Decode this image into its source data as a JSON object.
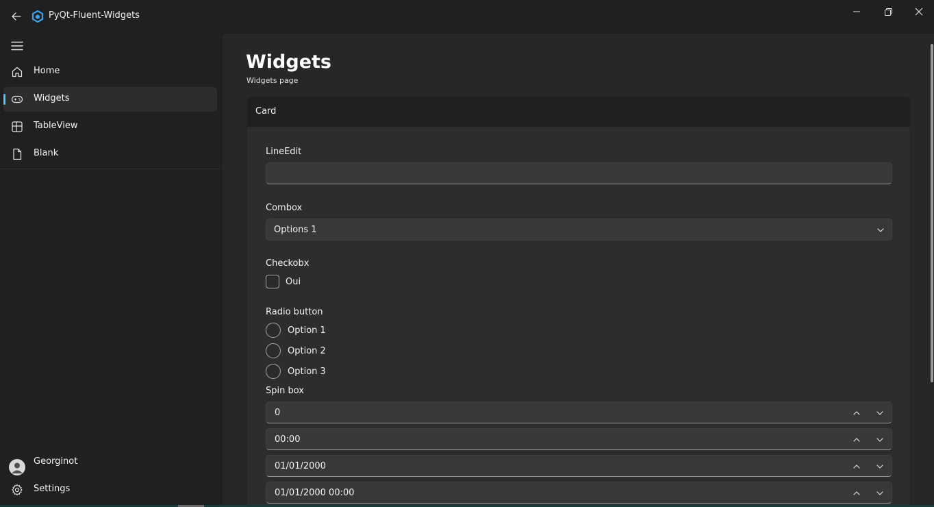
{
  "app": {
    "title": "PyQt-Fluent-Widgets"
  },
  "colors": {
    "accent": "#4cc2ff",
    "background": "#202020",
    "content": "#272727",
    "card": "#2d2d2d"
  },
  "sidebar": {
    "items": [
      {
        "label": "Home",
        "icon": "home-icon"
      },
      {
        "label": "Widgets",
        "icon": "gamepad-icon",
        "selected": true
      },
      {
        "label": "TableView",
        "icon": "table-icon"
      },
      {
        "label": "Blank",
        "icon": "document-icon"
      }
    ],
    "bottom": [
      {
        "label": "Georginot",
        "icon": "avatar"
      },
      {
        "label": "Settings",
        "icon": "gear-icon"
      }
    ]
  },
  "page": {
    "title": "Widgets",
    "subtitle": "Widgets page"
  },
  "card": {
    "header": "Card",
    "lineedit": {
      "label": "LineEdit",
      "value": ""
    },
    "combobox": {
      "label": "Combox",
      "value": "Options 1"
    },
    "checkbox": {
      "label": "Checkobx",
      "text": "Oui",
      "checked": false
    },
    "radio": {
      "label": "Radio button",
      "options": [
        "Option 1",
        "Option 2",
        "Option 3"
      ]
    },
    "spin": {
      "label": "Spin box",
      "values": [
        "0",
        "00:00",
        "01/01/2000",
        "01/01/2000 00:00"
      ]
    }
  }
}
